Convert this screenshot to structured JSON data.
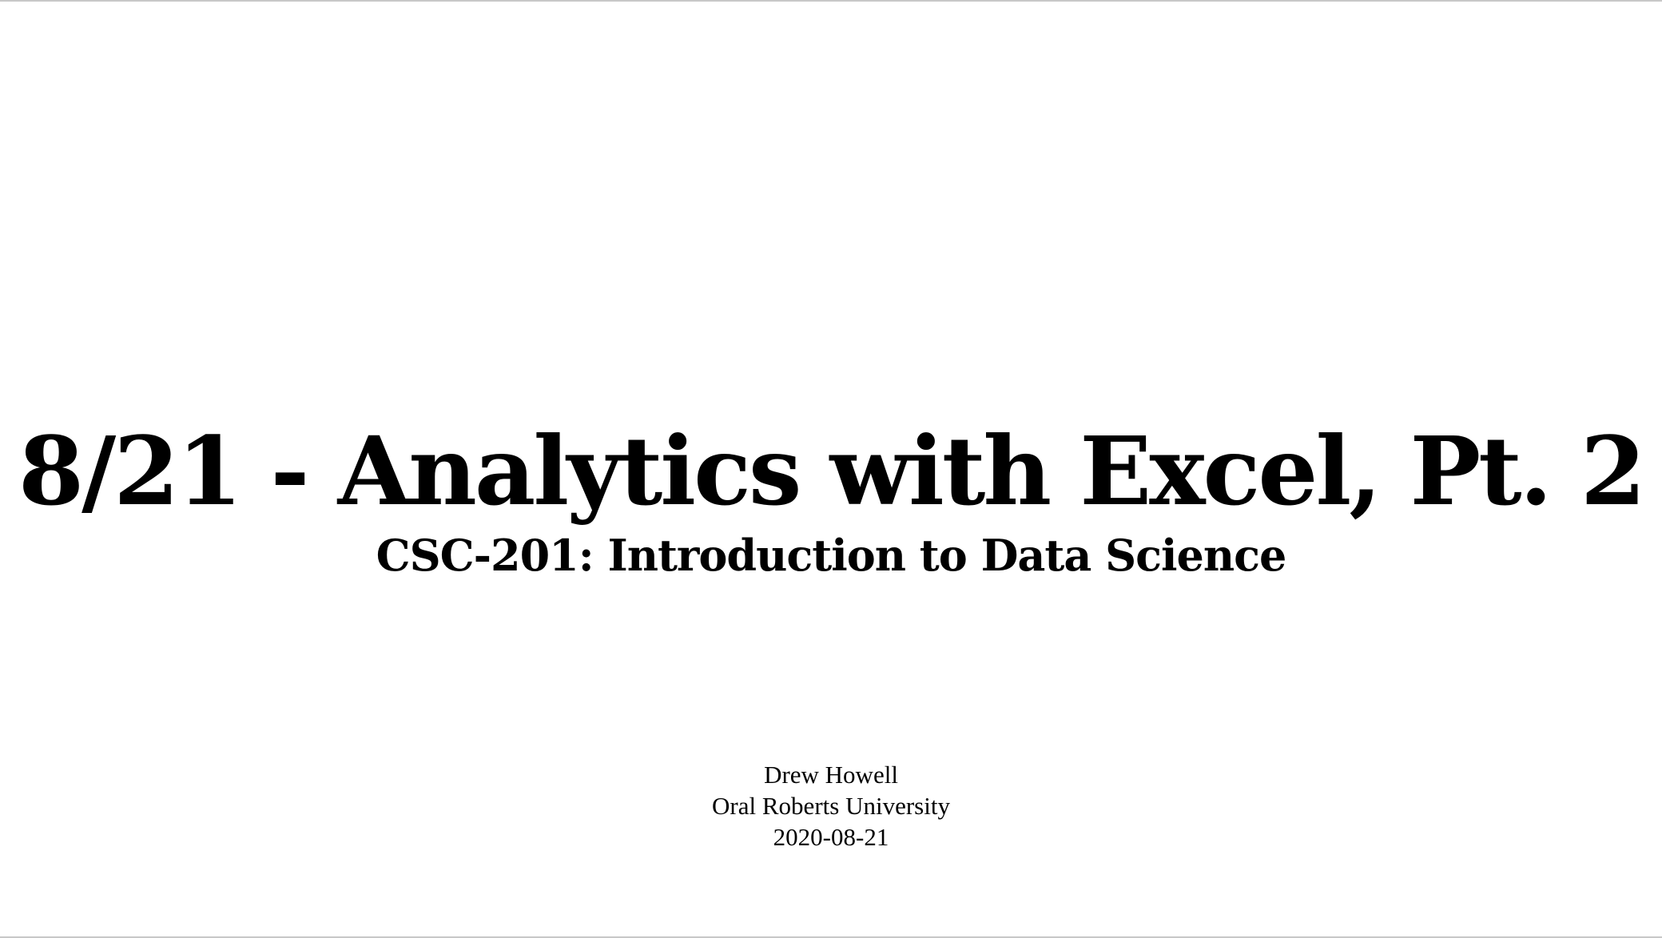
{
  "slide": {
    "title": "8/21 - Analytics with Excel, Pt. 2",
    "subtitle": "CSC-201: Introduction to Data Science",
    "author": "Drew Howell",
    "institution": "Oral Roberts University",
    "date": "2020-08-21"
  }
}
